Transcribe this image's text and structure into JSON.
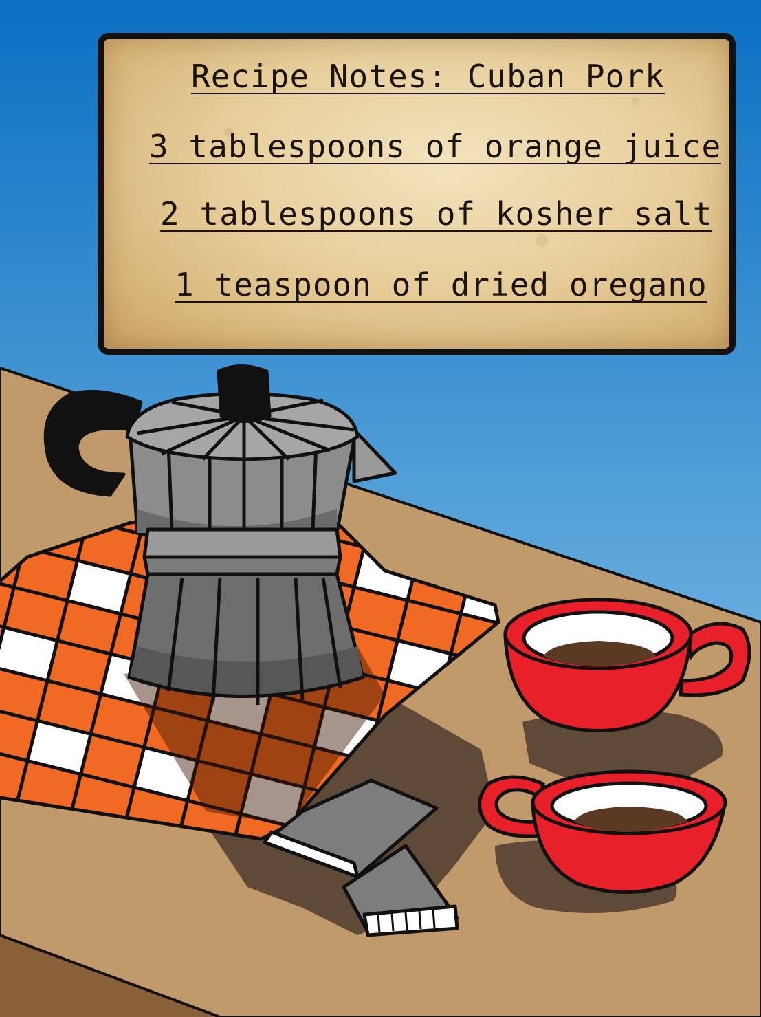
{
  "recipe_card": {
    "title": "Recipe Notes: Cuban Pork",
    "lines": [
      "3 tablespoons of orange juice",
      "2 tablespoons of kosher salt",
      "1 teaspoon of dried oregano"
    ]
  },
  "colors": {
    "sky_top": "#0a6fc2",
    "sky_bottom": "#9fd3ee",
    "table": "#c09a6b",
    "table_front": "#8a6038",
    "cloth_orange": "#f06a24",
    "cup_red": "#e8202a",
    "pot_gray": "#8c8c8c",
    "outline": "#111111"
  }
}
